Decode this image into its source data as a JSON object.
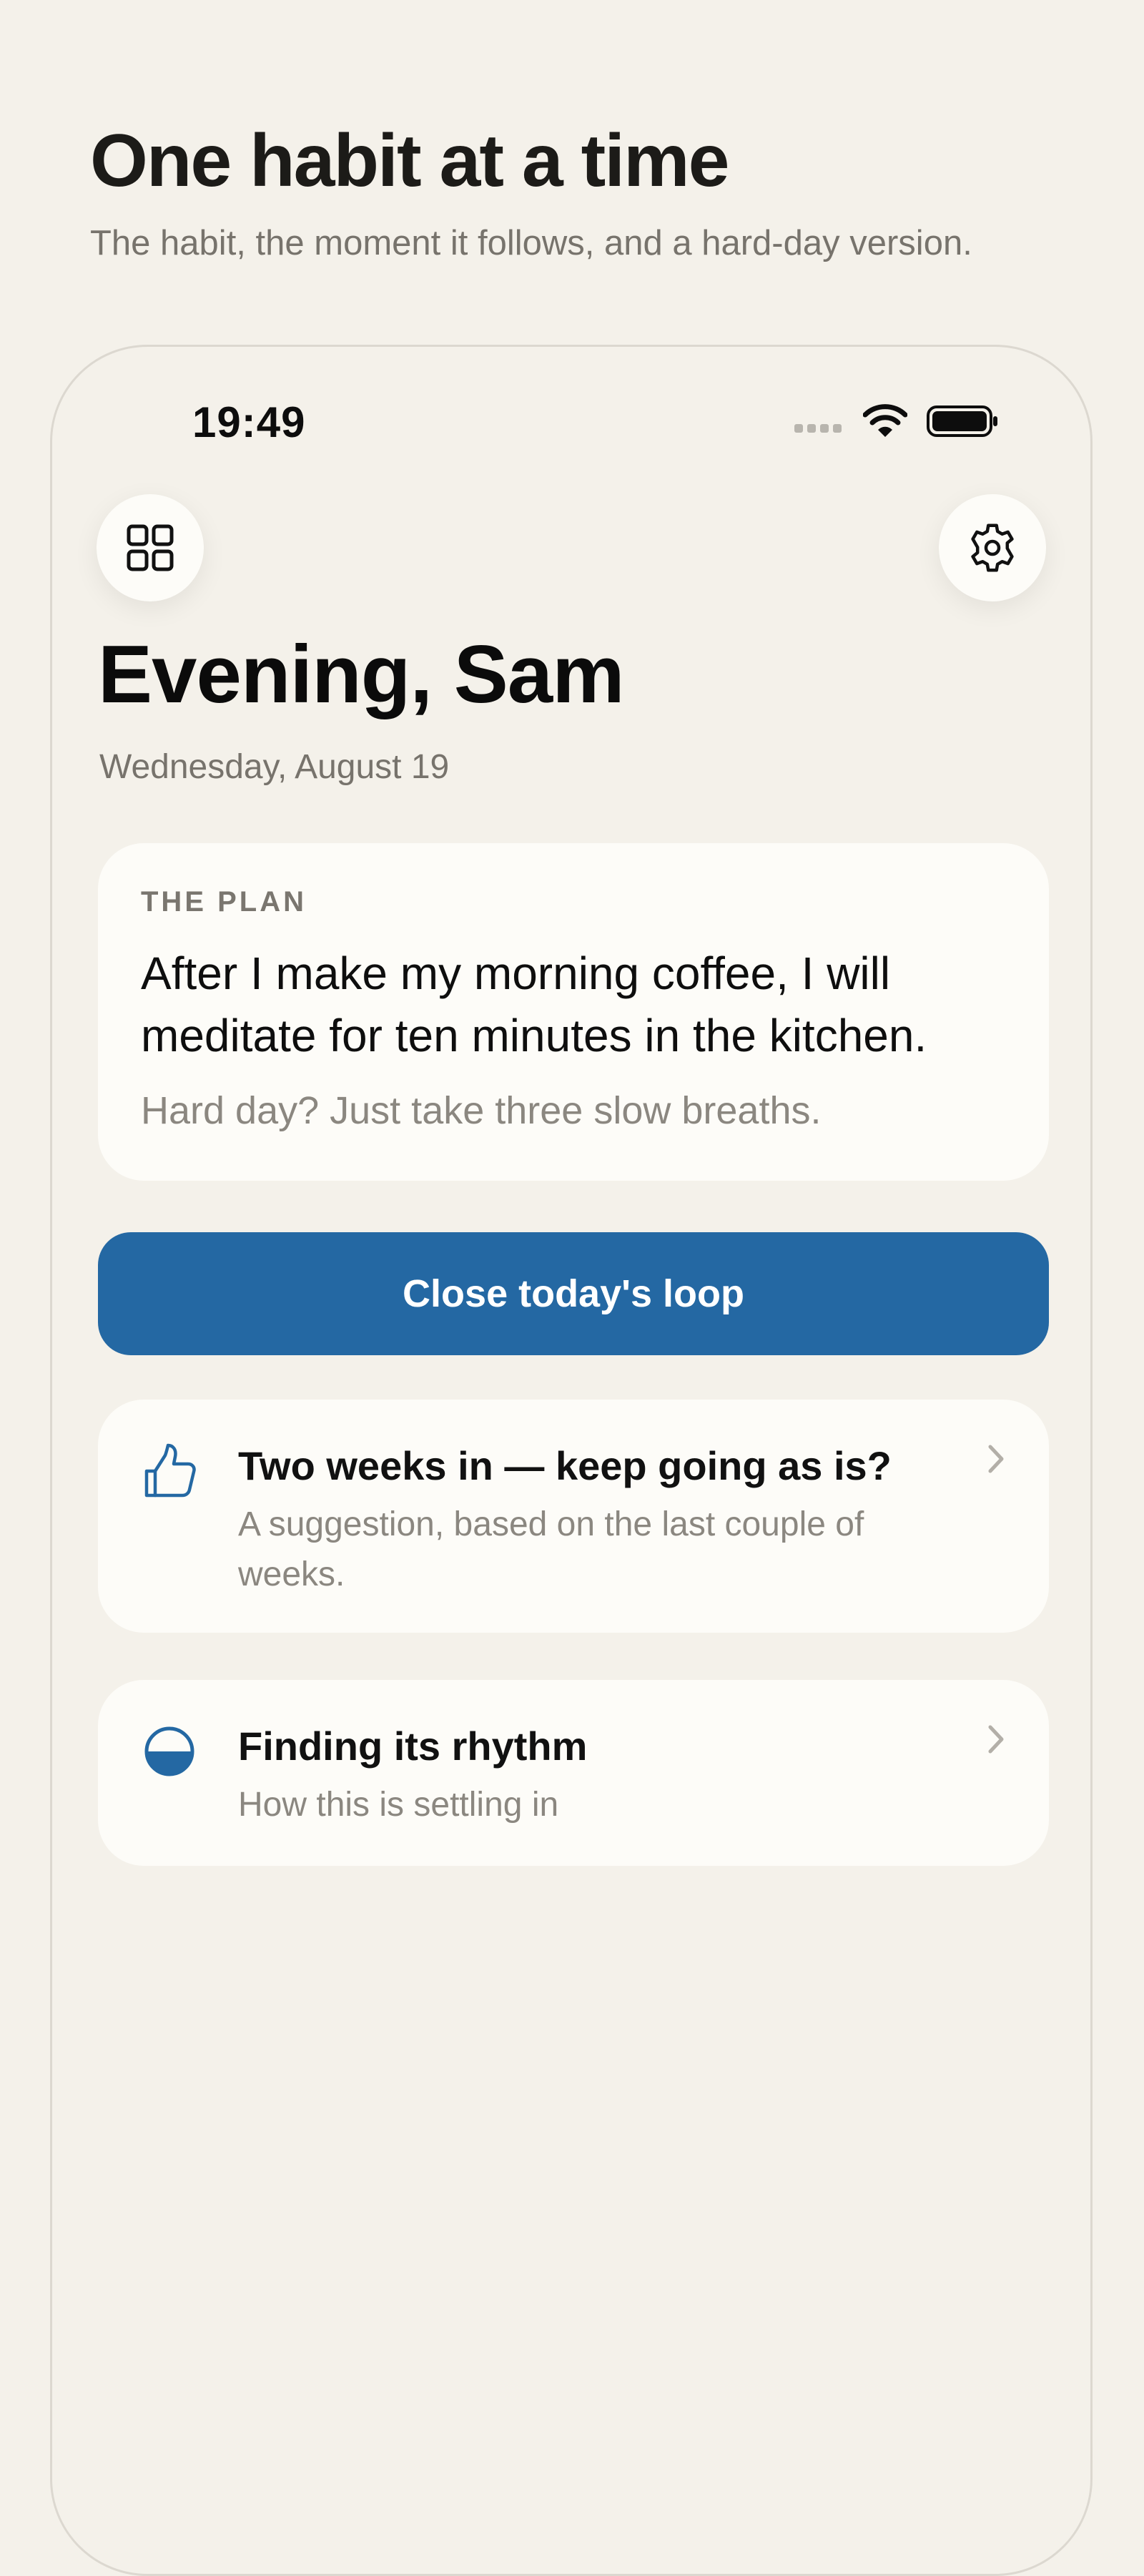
{
  "header": {
    "title": "One habit at a time",
    "subtitle": "The habit, the moment it follows, and a hard-day version."
  },
  "status_bar": {
    "time": "19:49",
    "icons": [
      "signal-dots-icon",
      "wifi-icon",
      "battery-icon"
    ]
  },
  "toolbar": {
    "left_icon": "grid-icon",
    "right_icon": "gear-icon"
  },
  "greeting": {
    "title": "Evening, Sam",
    "date": "Wednesday, August 19"
  },
  "plan": {
    "label": "THE PLAN",
    "text": "After I make my morning coffee, I will meditate for ten minutes in the kitchen.",
    "fallback": "Hard day? Just take three slow breaths."
  },
  "primary_action": {
    "label": "Close today's loop"
  },
  "cards": [
    {
      "icon": "thumbs-up-icon",
      "title": "Two weeks in — keep going as is?",
      "subtitle": "A suggestion, based on the last couple of weeks."
    },
    {
      "icon": "half-circle-icon",
      "title": "Finding its rhythm",
      "subtitle": "How this is settling in"
    }
  ],
  "colors": {
    "background": "#f4f1ea",
    "card": "#fdfcf8",
    "accent": "#2468a3",
    "muted_text": "#8b8780"
  }
}
